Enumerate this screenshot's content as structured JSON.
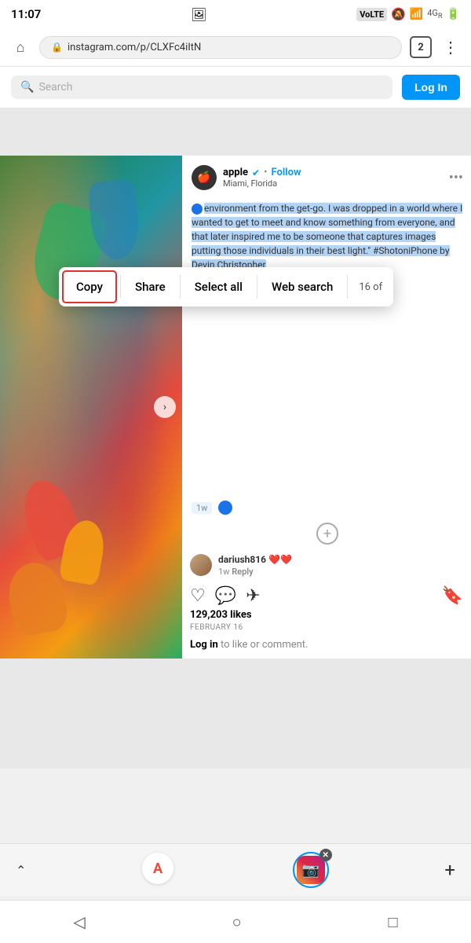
{
  "status_bar": {
    "time": "11:07",
    "volte_label": "VoLTE",
    "tab_count": "2"
  },
  "browser": {
    "url": "instagram.com/p/CLXFc4iItN",
    "tab_count": "2"
  },
  "search": {
    "placeholder": "Search",
    "login_label": "Log In"
  },
  "post": {
    "author_name": "apple",
    "author_location": "Miami, Florida",
    "follow_label": "Follow",
    "caption_before": "Commissioned by Apple.  Growing up in Miami has exposed me to a multicultural environment from the get-go. I was dropped in a world where I wanted to get to meet and know something from everyone, and that later inspired me to be someone that captures images putting those individuals in their best light.\" #ShotoniPhone by Devin Christopher",
    "comment_time": "1w",
    "commenter_name": "dariush816",
    "commenter_hearts": "❤️❤️",
    "commenter_time": "1w",
    "reply_label": "Reply",
    "likes": "129,203 likes",
    "date": "February 16",
    "login_comment": "Log in",
    "login_comment_suffix": " to like or comment."
  },
  "text_selection_popup": {
    "copy_label": "Copy",
    "share_label": "Share",
    "select_all_label": "Select all",
    "web_search_label": "Web search",
    "count_label": "16 of"
  },
  "bottom_bar": {
    "add_tab_label": "+"
  }
}
